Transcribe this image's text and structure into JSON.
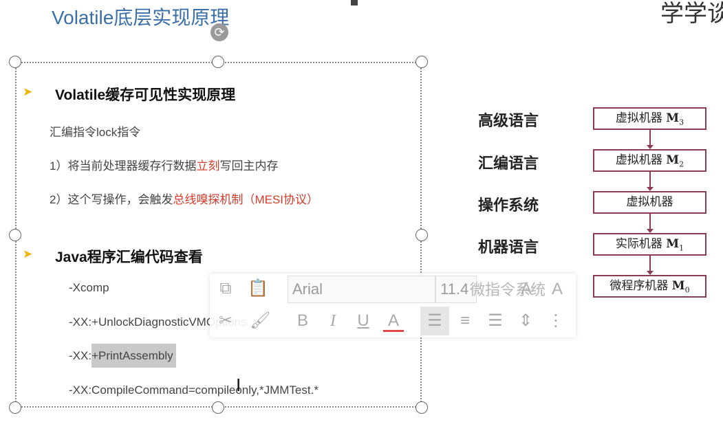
{
  "slide": {
    "title": "Volatile底层实现原理",
    "logo_text": "学学谈",
    "section1": {
      "heading": "Volatile缓存可见性实现原理",
      "lines": [
        {
          "parts": [
            "汇编指令lock指令"
          ]
        },
        {
          "parts": [
            "1）将当前处理器缓存行数据",
            "立刻",
            "写回主内存"
          ]
        },
        {
          "parts": [
            "2）这个写操作，会触发",
            "总线嗅探机制（MESI协议）"
          ]
        }
      ]
    },
    "section2": {
      "heading": "Java程序汇编代码查看",
      "lines": [
        {
          "prefix": "-Xcomp",
          "rest": ""
        },
        {
          "prefix": "-XX:+UnlockDiagnosticVMOptions",
          "rest": ""
        },
        {
          "prefix": "-XX:",
          "rest": "+PrintAssembly"
        },
        {
          "prefix": "-XX:CompileCommand=compileonly,*JMMTest.*",
          "rest": ""
        }
      ]
    }
  },
  "diagram": {
    "levels": [
      "高级语言",
      "汇编语言",
      "操作系统",
      "机器语言",
      "微指令系统"
    ],
    "machines": [
      {
        "name": "虚拟机器 ",
        "sub": "M",
        "idx": "3"
      },
      {
        "name": "虚拟机器 ",
        "sub": "M",
        "idx": "2"
      },
      {
        "name": "虚拟机器",
        "sub": "",
        "idx": ""
      },
      {
        "name": "实际机器 ",
        "sub": "M",
        "idx": "1"
      },
      {
        "name": "微程序机器 ",
        "sub": "M",
        "idx": "0"
      }
    ],
    "border_color": "#8a3b52"
  },
  "toolbar": {
    "font_name": "Arial",
    "font_size": "11.4",
    "icons": [
      "copy-icon",
      "paste-icon",
      "font-grow-icon",
      "font-shrink-icon",
      "cut-icon",
      "format-painter-icon",
      "bold-icon",
      "italic-icon",
      "underline-icon",
      "font-color-icon",
      "align-left-icon",
      "align-center-icon",
      "align-right-icon",
      "line-spacing-icon",
      "list-icon"
    ],
    "bold_label": "B",
    "italic_label": "I",
    "underline_label": "U",
    "font_color_label": "A",
    "grow_label": "A",
    "shrink_label": "A"
  }
}
